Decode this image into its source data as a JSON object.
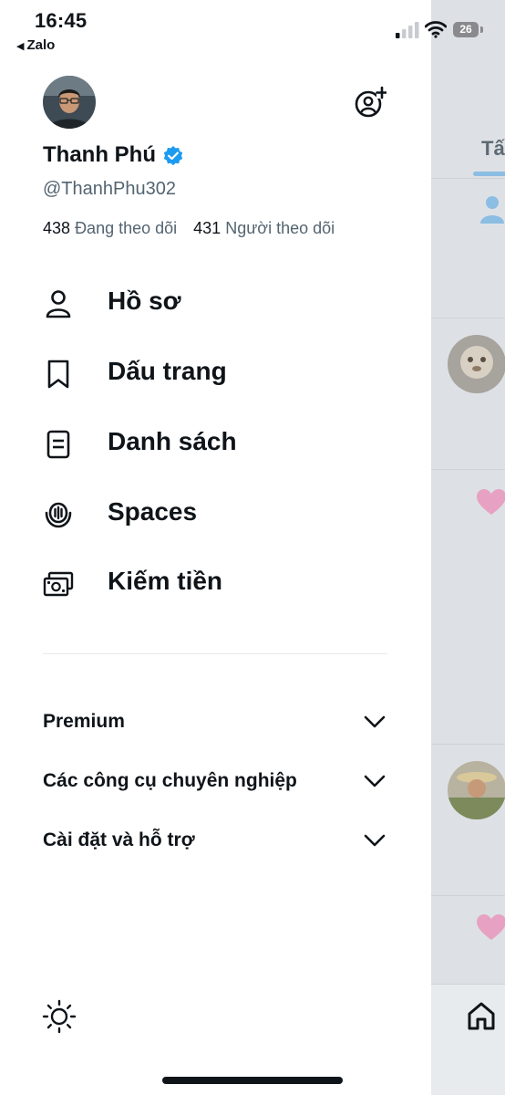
{
  "status_bar": {
    "time": "16:45",
    "back_app": "Zalo",
    "battery": "26"
  },
  "profile": {
    "name": "Thanh Phú",
    "handle": "@ThanhPhu302",
    "following_count": "438",
    "following_label": "Đang theo dõi",
    "followers_count": "431",
    "followers_label": "Người theo dõi",
    "verified_color": "#1d9bf0"
  },
  "menu": {
    "items": [
      {
        "label": "Hồ sơ",
        "icon": "person-icon"
      },
      {
        "label": "Dấu trang",
        "icon": "bookmark-icon"
      },
      {
        "label": "Danh sách",
        "icon": "list-icon"
      },
      {
        "label": "Spaces",
        "icon": "spaces-icon"
      },
      {
        "label": "Kiếm tiền",
        "icon": "money-icon"
      }
    ]
  },
  "sections": [
    {
      "label": "Premium"
    },
    {
      "label": "Các công cụ chuyên nghiệp"
    },
    {
      "label": "Cài đặt và hỗ trợ"
    }
  ],
  "background_feed": {
    "tab_label": "Tấ"
  },
  "colors": {
    "text": "#0f1419",
    "secondary_text": "#536471",
    "accent": "#1d9bf0",
    "heart": "#e7a2c3"
  }
}
